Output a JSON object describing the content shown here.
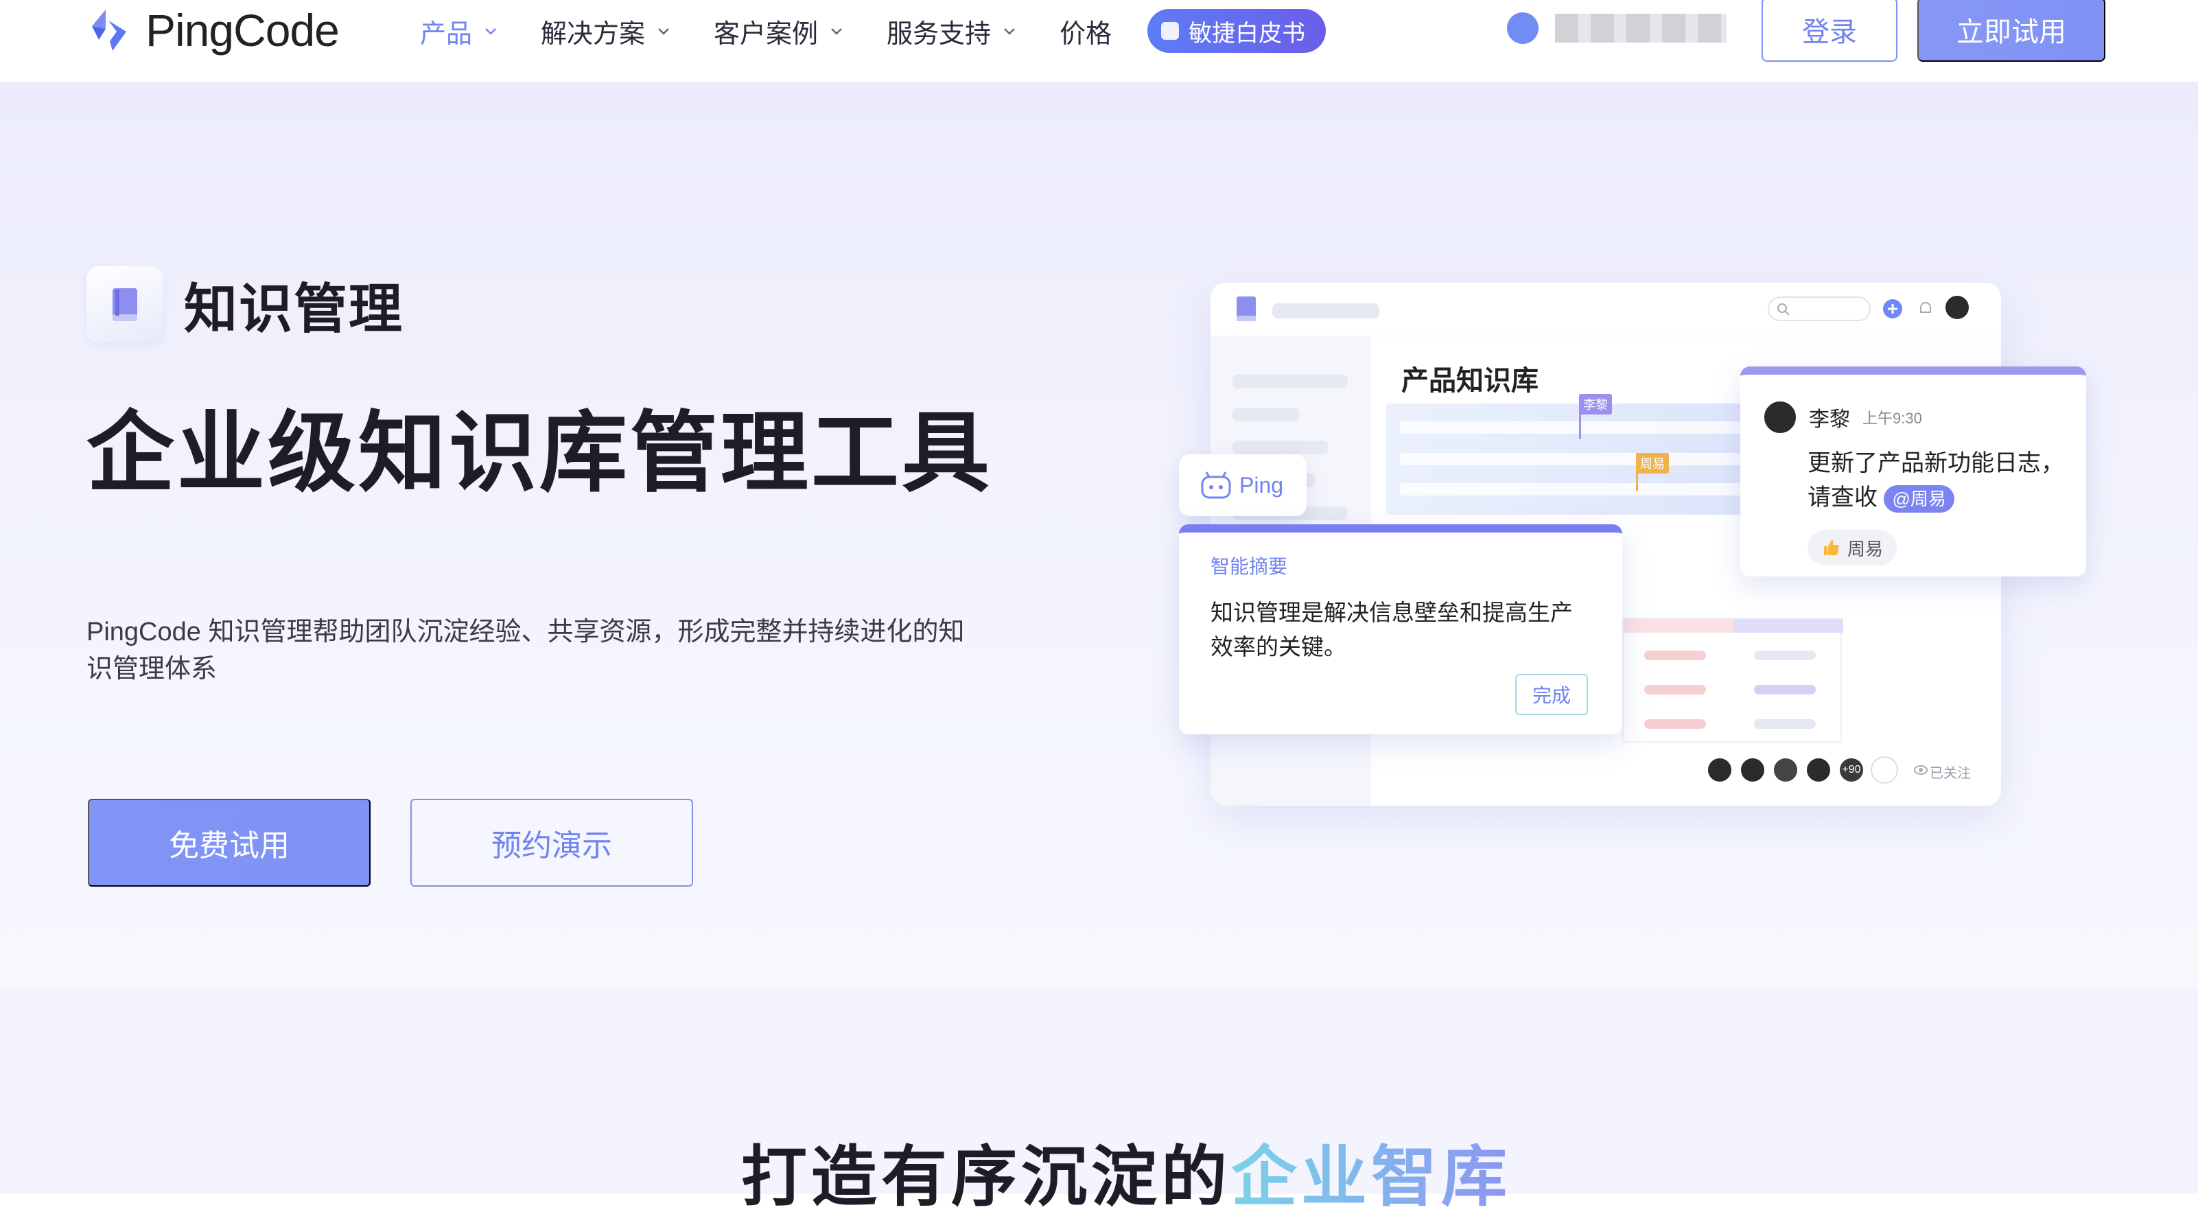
{
  "header": {
    "brand": "PingCode",
    "nav": [
      {
        "label": "产品",
        "active": true,
        "dropdown": true
      },
      {
        "label": "解决方案",
        "active": false,
        "dropdown": true
      },
      {
        "label": "客户案例",
        "active": false,
        "dropdown": true
      },
      {
        "label": "服务支持",
        "active": false,
        "dropdown": true
      },
      {
        "label": "价格",
        "active": false,
        "dropdown": false
      }
    ],
    "whitepaper": "敏捷白皮书",
    "login": "登录",
    "trial": "立即试用"
  },
  "hero": {
    "product_name": "知识管理",
    "title": "企业级知识库管理工具",
    "description": "PingCode 知识管理帮助团队沉淀经验、共享资源，形成完整并持续进化的知识管理体系",
    "primary_button": "免费试用",
    "secondary_button": "预约演示"
  },
  "illustration": {
    "kb_title": "产品知识库",
    "tag_a": "李黎",
    "tag_b": "周易",
    "ping_label": "Ping",
    "summary_label": "智能摘要",
    "summary_text": "知识管理是解决信息壁垒和提高生产效率的关键。",
    "summary_done": "完成",
    "comment_name": "李黎",
    "comment_time": "上午9:30",
    "comment_text": "更新了产品新功能日志，请查收",
    "comment_mention": "@周易",
    "comment_like": "周易",
    "avatars_more": "+90",
    "follow_label": "已关注"
  },
  "section2": {
    "title_main": "打造有序沉淀的",
    "title_highlight": "企业智库"
  },
  "colors": {
    "accent": "#6f82f2",
    "accent_button": "#8294f6",
    "hero_bg": "#eeeffc"
  },
  "icons": [
    "pingcode-logo-icon",
    "chevron-down-icon",
    "whitepaper-icon",
    "phone-icon",
    "book-icon",
    "search-icon",
    "plus-icon",
    "bell-icon",
    "ping-robot-icon",
    "thumbs-up-icon",
    "eye-icon"
  ]
}
